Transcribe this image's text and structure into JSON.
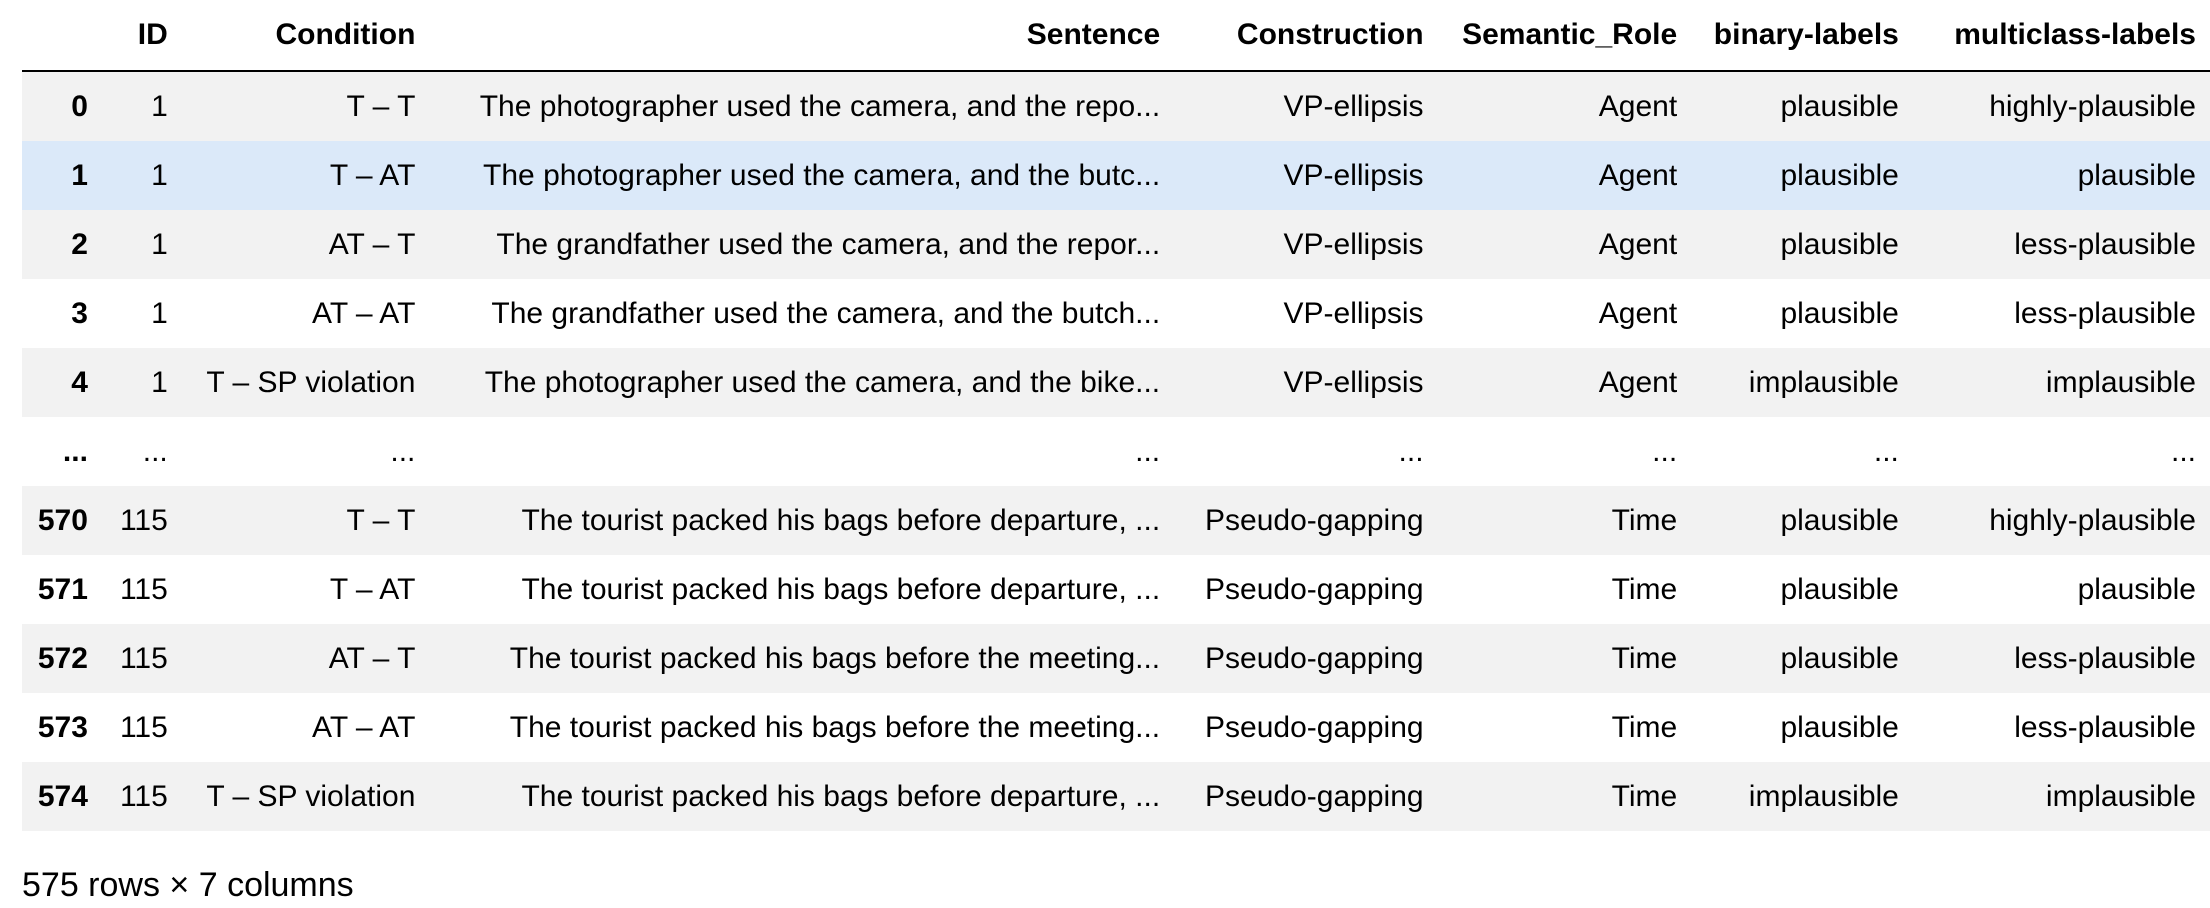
{
  "table": {
    "index_header": "",
    "columns": [
      "ID",
      "Condition",
      "Sentence",
      "Construction",
      "Semantic_Role",
      "binary-labels",
      "multiclass-labels"
    ],
    "rows": [
      {
        "index": "0",
        "cells": [
          "1",
          "T – T",
          "The photographer used the camera, and the repo...",
          "VP-ellipsis",
          "Agent",
          "plausible",
          "highly-plausible"
        ]
      },
      {
        "index": "1",
        "cells": [
          "1",
          "T – AT",
          "The photographer used the camera, and the butc...",
          "VP-ellipsis",
          "Agent",
          "plausible",
          "plausible"
        ]
      },
      {
        "index": "2",
        "cells": [
          "1",
          "AT – T",
          "The grandfather used the camera, and the repor...",
          "VP-ellipsis",
          "Agent",
          "plausible",
          "less-plausible"
        ]
      },
      {
        "index": "3",
        "cells": [
          "1",
          "AT – AT",
          "The grandfather used the camera, and the butch...",
          "VP-ellipsis",
          "Agent",
          "plausible",
          "less-plausible"
        ]
      },
      {
        "index": "4",
        "cells": [
          "1",
          "T – SP violation",
          "The photographer used the camera, and the bike...",
          "VP-ellipsis",
          "Agent",
          "implausible",
          "implausible"
        ]
      },
      {
        "index": "...",
        "cells": [
          "...",
          "...",
          "...",
          "...",
          "...",
          "...",
          "..."
        ]
      },
      {
        "index": "570",
        "cells": [
          "115",
          "T – T",
          "The tourist packed his bags before departure, ...",
          "Pseudo-gapping",
          "Time",
          "plausible",
          "highly-plausible"
        ]
      },
      {
        "index": "571",
        "cells": [
          "115",
          "T – AT",
          "The tourist packed his bags before departure, ...",
          "Pseudo-gapping",
          "Time",
          "plausible",
          "plausible"
        ]
      },
      {
        "index": "572",
        "cells": [
          "115",
          "AT – T",
          "The tourist packed his bags before the meeting...",
          "Pseudo-gapping",
          "Time",
          "plausible",
          "less-plausible"
        ]
      },
      {
        "index": "573",
        "cells": [
          "115",
          "AT – AT",
          "The tourist packed his bags before the meeting...",
          "Pseudo-gapping",
          "Time",
          "plausible",
          "less-plausible"
        ]
      },
      {
        "index": "574",
        "cells": [
          "115",
          "T – SP violation",
          "The tourist packed his bags before departure, ...",
          "Pseudo-gapping",
          "Time",
          "implausible",
          "implausible"
        ]
      }
    ],
    "highlighted_row_index": "1"
  },
  "summary": "575 rows × 7 columns",
  "colors": {
    "stripe": "#f2f2f2",
    "highlight": "#dbe9f9",
    "header_rule": "#000000"
  }
}
